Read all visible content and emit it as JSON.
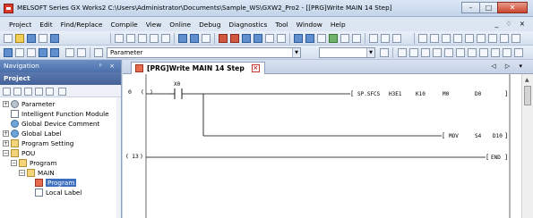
{
  "window": {
    "title": "MELSOFT Series GX Works2 C:\\Users\\Administrator\\Documents\\Sample_WS\\GXW2_Pro2 - [[PRG]Write MAIN 14 Step]",
    "minimize": "–",
    "maximize": "□",
    "close": "✕"
  },
  "menu": {
    "items": [
      "Project",
      "Edit",
      "Find/Replace",
      "Compile",
      "View",
      "Online",
      "Debug",
      "Diagnostics",
      "Tool",
      "Window",
      "Help"
    ],
    "mdi_controls": "_ ♢ ×"
  },
  "toolbar": {
    "parameter_dropdown": "Parameter"
  },
  "navigation": {
    "title": "Navigation",
    "pin": "ᵖ ×",
    "section": "Project",
    "tree": [
      {
        "label": "Parameter",
        "exp": "+"
      },
      {
        "label": "Intelligent Function Module",
        "exp": ""
      },
      {
        "label": "Global Device Comment",
        "exp": ""
      },
      {
        "label": "Global Label",
        "exp": "+"
      },
      {
        "label": "Program Setting",
        "exp": "+"
      },
      {
        "label": "POU",
        "exp": "−"
      },
      {
        "label": "Program",
        "exp": "−"
      },
      {
        "label": "MAIN",
        "exp": "−"
      },
      {
        "label": "Program",
        "exp": ""
      },
      {
        "label": "Local Label",
        "exp": ""
      }
    ]
  },
  "editor": {
    "tab_label": "[PRG]Write MAIN 14 Step",
    "tab_close": "×",
    "tab_nav": "◁ ▷ ▾",
    "rungs": [
      {
        "step": "0",
        "contact": "X0",
        "instr": "SP.SFCS",
        "ops": [
          "H3E1",
          "K10",
          "M0",
          "D0"
        ]
      },
      {
        "instr": "MOV",
        "ops": [
          "S4",
          "D10"
        ]
      },
      {
        "step": "13",
        "instr": "END"
      }
    ]
  }
}
